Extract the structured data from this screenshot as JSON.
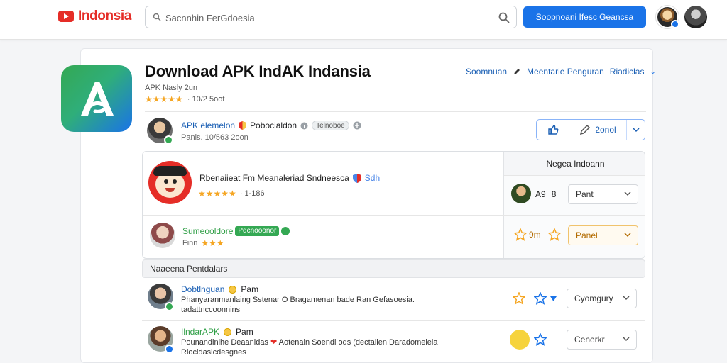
{
  "header": {
    "brand": "Indonsia",
    "search_placeholder": "Sacnnhin FerGdoesia",
    "cta_label": "Soopnoani Ifesc Geancsa"
  },
  "app": {
    "title": "Download APK IndAK Indansia",
    "subtitle": "APK Nasly 2un",
    "stars": "★★★★★",
    "rating_text": "· 10/2 5oot",
    "links": [
      "Soomnuan",
      "Meentarie Penguran",
      "Riadiclas"
    ]
  },
  "publisher": {
    "name": "APK elemelon",
    "label": "Pobocialdon",
    "pill": "Telnoboe",
    "subline": "Panis. 10/563 2oon",
    "button_label": "2onol"
  },
  "panel": {
    "right_header": "Negea Indoann",
    "row1_title": "Rbenaiieat Fm Meanaleriad Sndneesca",
    "row1_tag": "Sdh",
    "row1_stars": "★★★★★",
    "row1_rating": "· 1-186",
    "mini_name": "A9",
    "mini_sep": "8",
    "dd1_value": "Pant",
    "row2_name": "Sumeooldore",
    "row2_pill": "Pdcnooonor",
    "row2_sub": "Finn",
    "row2_stars": "★★★",
    "row2_right_label": "9m",
    "dd2_value": "Panel"
  },
  "section": {
    "title": "Naaeena Pentdalars"
  },
  "comments": [
    {
      "name": "Dobtlnguan",
      "meta": "Pam",
      "body1": "Phanyaranmanlaing Sstenar O Bragamenan bade Ran Gefasoesia.",
      "body2": "tadattnccoonnins",
      "dd_value": "Cyomgury"
    },
    {
      "name": "IlndarAPK",
      "meta": "Pam",
      "body1a": "Pounandinihe Deaanidas",
      "body1b": "Aotenaln Soendl ods (dectalien Daradomeleia",
      "body2": "Riocldasicdesgnes",
      "dd_value": "Cenerkr"
    }
  ],
  "colors": {
    "brand_red": "#e52d27",
    "accent_blue": "#1a73e8",
    "star_gold": "#f5a623",
    "verified_green": "#34a853"
  }
}
